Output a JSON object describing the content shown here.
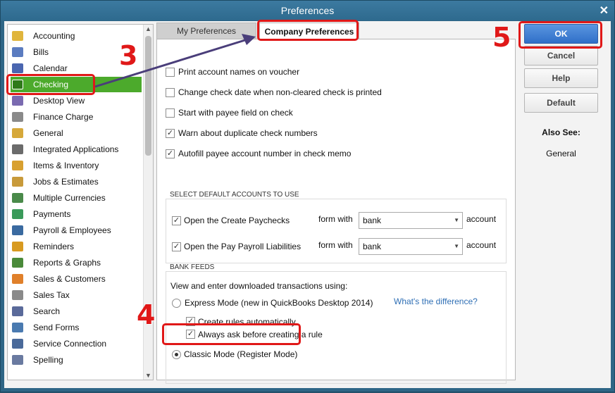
{
  "window": {
    "title": "Preferences"
  },
  "sidebar": {
    "items": [
      {
        "label": "Accounting",
        "icon": "accounting-icon",
        "color": "#e0b53c"
      },
      {
        "label": "Bills",
        "icon": "bills-icon",
        "color": "#5b7cc0"
      },
      {
        "label": "Calendar",
        "icon": "calendar-icon",
        "color": "#4a66b0"
      },
      {
        "label": "Checking",
        "icon": "checking-icon",
        "color": "#ffffff",
        "selected": true
      },
      {
        "label": "Desktop View",
        "icon": "desktop-view-icon",
        "color": "#7a6ab0"
      },
      {
        "label": "Finance Charge",
        "icon": "finance-charge-icon",
        "color": "#8a8a8a"
      },
      {
        "label": "General",
        "icon": "general-icon",
        "color": "#d6a83a"
      },
      {
        "label": "Integrated Applications",
        "icon": "integrated-applications-icon",
        "color": "#6b6b6b"
      },
      {
        "label": "Items & Inventory",
        "icon": "items-inventory-icon",
        "color": "#d8a030"
      },
      {
        "label": "Jobs & Estimates",
        "icon": "jobs-estimates-icon",
        "color": "#c89a3a"
      },
      {
        "label": "Multiple Currencies",
        "icon": "multiple-currencies-icon",
        "color": "#4a8a4a"
      },
      {
        "label": "Payments",
        "icon": "payments-icon",
        "color": "#3a9a5a"
      },
      {
        "label": "Payroll & Employees",
        "icon": "payroll-employees-icon",
        "color": "#3a6aa0"
      },
      {
        "label": "Reminders",
        "icon": "reminders-icon",
        "color": "#d89a20"
      },
      {
        "label": "Reports & Graphs",
        "icon": "reports-graphs-icon",
        "color": "#4a8a3a"
      },
      {
        "label": "Sales & Customers",
        "icon": "sales-customers-icon",
        "color": "#e0802a"
      },
      {
        "label": "Sales Tax",
        "icon": "sales-tax-icon",
        "color": "#8a8a8a"
      },
      {
        "label": "Search",
        "icon": "search-icon",
        "color": "#5a6a9a"
      },
      {
        "label": "Send Forms",
        "icon": "send-forms-icon",
        "color": "#4a7ab0"
      },
      {
        "label": "Service Connection",
        "icon": "service-connection-icon",
        "color": "#4a6a9a"
      },
      {
        "label": "Spelling",
        "icon": "spelling-icon",
        "color": "#6a7aa0"
      }
    ]
  },
  "tabs": {
    "my": "My Preferences",
    "company": "Company Preferences"
  },
  "options": [
    {
      "label": "Print account names on voucher",
      "checked": false
    },
    {
      "label": "Change check date when non-cleared check is printed",
      "checked": false
    },
    {
      "label": "Start with payee field on check",
      "checked": false
    },
    {
      "label": "Warn about duplicate check numbers",
      "checked": true
    },
    {
      "label": "Autofill payee account number in check memo",
      "checked": true
    }
  ],
  "default_accounts": {
    "title": "SELECT DEFAULT ACCOUNTS TO USE",
    "rows": [
      {
        "label": "Open the Create Paychecks",
        "checked": true,
        "form_with": "form with",
        "value": "bank",
        "suffix": "account"
      },
      {
        "label": "Open the Pay Payroll Liabilities",
        "checked": true,
        "form_with": "form with",
        "value": "bank",
        "suffix": "account"
      }
    ]
  },
  "bank_feeds": {
    "title": "BANK FEEDS",
    "intro": "View and enter downloaded transactions using:",
    "express": "Express Mode (new in QuickBooks Desktop 2014)",
    "difference_link": "What's the difference?",
    "create_rules": "Create rules automatically",
    "ask_rule": "Always ask before creating a rule",
    "classic": "Classic Mode (Register Mode)",
    "selected_mode": "classic"
  },
  "buttons": {
    "ok": "OK",
    "cancel": "Cancel",
    "help": "Help",
    "default": "Default"
  },
  "also_see": {
    "title": "Also See:",
    "link": "General"
  },
  "annotations": {
    "step3": "3",
    "step4": "4",
    "step5": "5",
    "color": "#e01818"
  }
}
